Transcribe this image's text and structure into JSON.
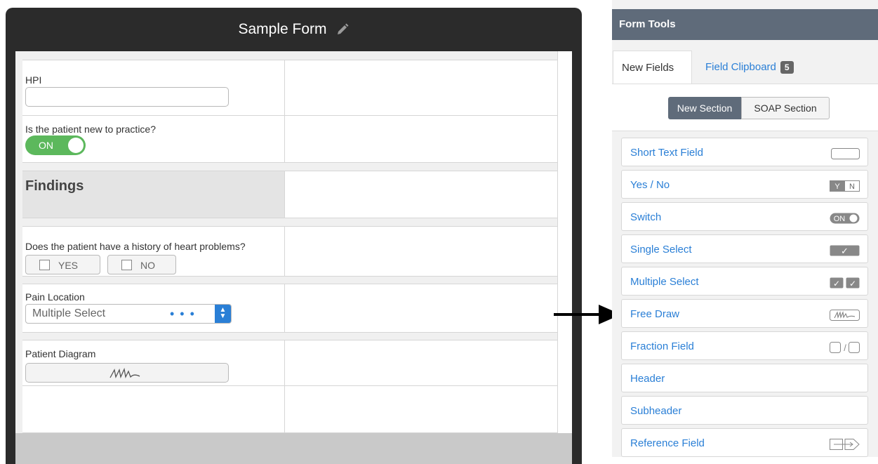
{
  "form": {
    "title": "Sample Form",
    "hpi_label": "HPI",
    "new_patient_label": "Is the patient new to practice?",
    "switch_value": "ON",
    "findings_header": "Findings",
    "heart_question": "Does the patient have a history of heart problems?",
    "yes_label": "YES",
    "no_label": "NO",
    "pain_location_label": "Pain Location",
    "pain_select_value": "Multiple Select",
    "diagram_label": "Patient Diagram"
  },
  "tools": {
    "title": "Form Tools",
    "tabs": [
      {
        "label": "New Fields"
      },
      {
        "label": "Field Clipboard",
        "badge": "5"
      }
    ],
    "section_buttons": [
      {
        "label": "New Section"
      },
      {
        "label": "SOAP Section"
      }
    ],
    "items": [
      {
        "label": "Short Text Field",
        "icon": "text-field-icon"
      },
      {
        "label": "Yes / No",
        "icon": "yes-no-icon",
        "icon_text": [
          "Y",
          "N"
        ]
      },
      {
        "label": "Switch",
        "icon": "switch-icon",
        "icon_text": "ON"
      },
      {
        "label": "Single Select",
        "icon": "checkmark-icon",
        "icon_text": "✓"
      },
      {
        "label": "Multiple Select",
        "icon": "double-checkmark-icon",
        "icon_text": [
          "✓",
          "✓"
        ]
      },
      {
        "label": "Free Draw",
        "icon": "scribble-icon"
      },
      {
        "label": "Fraction Field",
        "icon": "fraction-icon",
        "icon_text": "/"
      },
      {
        "label": "Header",
        "icon": ""
      },
      {
        "label": "Subheader",
        "icon": ""
      },
      {
        "label": "Reference Field",
        "icon": "reference-icon"
      }
    ]
  },
  "colors": {
    "accent": "#2a7fd6",
    "switch_on": "#5cb85c",
    "panel_header": "#5f6b7a",
    "editor_frame": "#2b2b2b"
  }
}
